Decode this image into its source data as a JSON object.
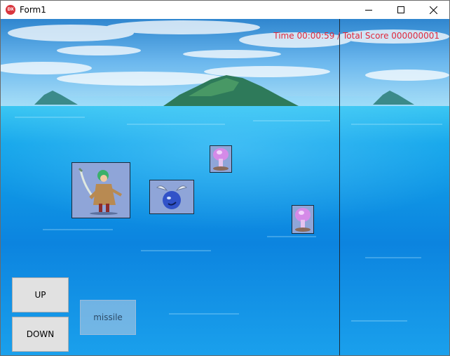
{
  "window": {
    "title": "Form1",
    "icon_text": "DX",
    "controls": [
      "minimize-icon",
      "maximize-icon",
      "close-icon"
    ]
  },
  "hud": {
    "text": "Time 00:00:59 / Total Score 000000001",
    "color": "#e0283c"
  },
  "buttons": {
    "up": "UP",
    "down": "DOWN",
    "missile": "missile"
  },
  "sprites": {
    "player": "swordsman-player-sprite",
    "enemy": "blue-winged-blob-enemy-sprite",
    "missiles": [
      "pink-mushroom-missile-sprite",
      "pink-mushroom-missile-sprite"
    ]
  },
  "colors": {
    "sky": "#4aa0e0",
    "sea": "#0a8ee0",
    "hud_text": "#e0283c"
  }
}
